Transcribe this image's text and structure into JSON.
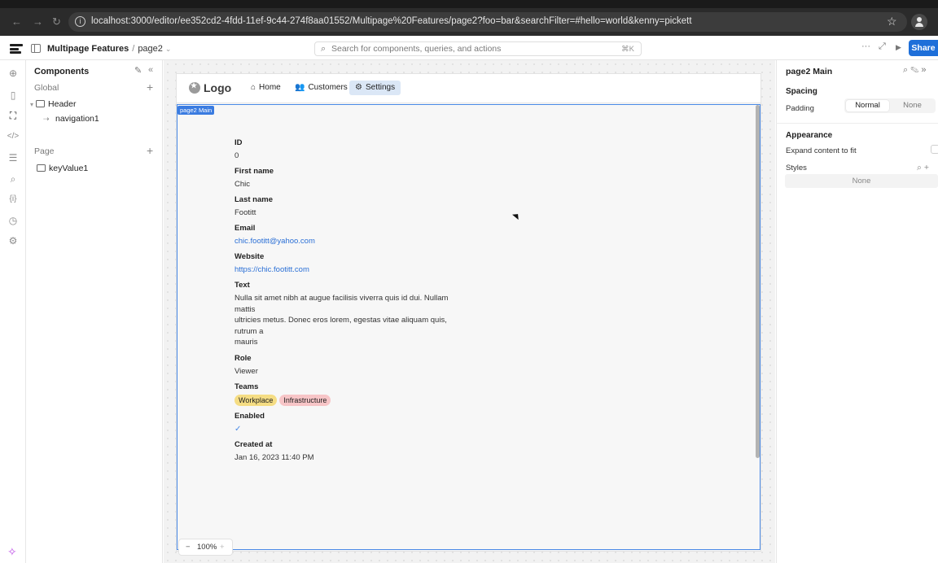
{
  "browser": {
    "back": "←",
    "forward": "→",
    "reload": "↻",
    "url": "localhost:3000/editor/ee352cd2-4fdd-11ef-9c44-274f8aa01552/Multipage%20Features/page2?foo=bar&searchFilter=#hello=world&kenny=pickett"
  },
  "toolbar": {
    "app_name": "Multipage Features",
    "separator": "/",
    "page_name": "page2",
    "search_placeholder": "Search for components, queries, and actions",
    "search_shortcut": "⌘K",
    "more": "···",
    "expand": "⤢",
    "preview": "▶",
    "share": "Share"
  },
  "components_panel": {
    "title": "Components",
    "global_label": "Global",
    "page_label": "Page",
    "global_items": [
      {
        "label": "Header"
      },
      {
        "label": "navigation1"
      }
    ],
    "page_items": [
      {
        "label": "keyValue1"
      }
    ]
  },
  "app_header": {
    "brand": "Logo",
    "nav": [
      {
        "label": "Home",
        "icon": "home-icon",
        "glyph": "⌂"
      },
      {
        "label": "Customers",
        "icon": "users-icon",
        "glyph": "👥"
      },
      {
        "label": "Settings",
        "icon": "gear-icon",
        "glyph": "⚙"
      }
    ]
  },
  "main_frame": {
    "tag": "page2 Main"
  },
  "key_value": {
    "fields": [
      {
        "label": "ID",
        "value": "0"
      },
      {
        "label": "First name",
        "value": "Chic"
      },
      {
        "label": "Last name",
        "value": "Footitt"
      },
      {
        "label": "Email",
        "value": "chic.footitt@yahoo.com"
      },
      {
        "label": "Website",
        "value": "https://chic.footitt.com"
      },
      {
        "label": "Text",
        "value_lines": [
          "Nulla sit amet nibh at augue facilisis viverra quis id dui. Nullam mattis",
          "ultricies metus. Donec eros lorem, egestas vitae aliquam quis, rutrum a",
          "mauris"
        ]
      },
      {
        "label": "Role",
        "value": "Viewer"
      },
      {
        "label": "Teams",
        "tags": [
          {
            "label": "Workplace",
            "color": "#f5dd84"
          },
          {
            "label": "Infrastructure",
            "color": "#f7c5c7"
          }
        ]
      },
      {
        "label": "Enabled",
        "value": "✓"
      },
      {
        "label": "Created at",
        "value": "Jan 16, 2023 11:40 PM"
      }
    ]
  },
  "zoom": {
    "minus": "−",
    "value": "100%",
    "plus": "+"
  },
  "inspector": {
    "title": "page2 Main",
    "spacing_label": "Spacing",
    "padding_label": "Padding",
    "padding_options": [
      "Normal",
      "None"
    ],
    "appearance_label": "Appearance",
    "expand_label": "Expand content to fit",
    "styles_label": "Styles",
    "styles_value": "None"
  },
  "colors": {
    "accent": "#1e6fd9",
    "selection": "#4a8ae6",
    "link": "#2a6fd6",
    "assist": "#c056e8"
  }
}
